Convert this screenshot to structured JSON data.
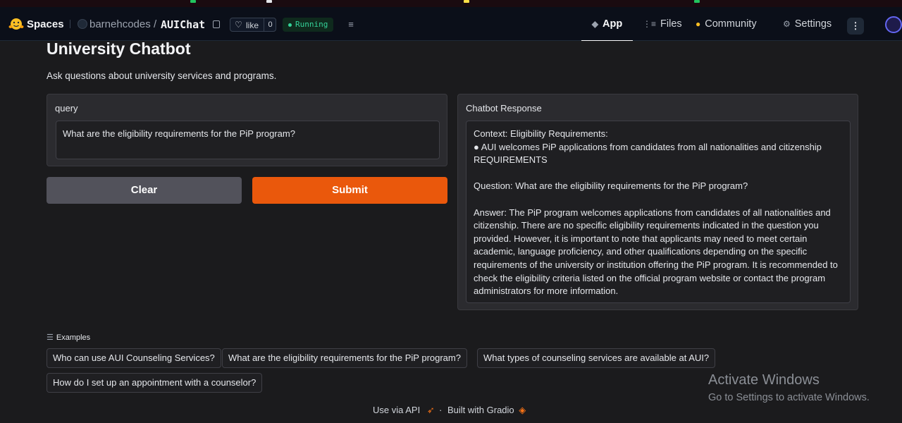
{
  "header": {
    "brand": "Spaces",
    "owner": "barnehcodes",
    "slash": "/",
    "repo": "AUIChat",
    "like_label": "like",
    "like_count": "0",
    "status": "Running",
    "nav": {
      "app": "App",
      "files": "Files",
      "community": "Community",
      "settings": "Settings"
    }
  },
  "page": {
    "title": "University Chatbot",
    "description": "Ask questions about university services and programs."
  },
  "query": {
    "label": "query",
    "value": "What are the eligibility requirements for the PiP program?"
  },
  "buttons": {
    "clear": "Clear",
    "submit": "Submit"
  },
  "response": {
    "label": "Chatbot Response",
    "lines": [
      "Context: Eligibility  Requirements:",
      "● AUI welcomes PiP applications from candidates from all nationalities and citizenship REQUIREMENTS",
      "",
      "Question: What are the eligibility requirements for the PiP program?",
      "",
      "Answer: The PiP program welcomes applications from candidates of all nationalities and citizenship. There are no specific eligibility requirements indicated in the question you provided. However, it is important to note that applicants may need to meet certain academic, language proficiency, and other qualifications depending on the specific requirements of the university or institution offering the PiP program. It is recommended to check the eligibility criteria listed on the official program website or contact the program administrators for more information."
    ]
  },
  "examples": {
    "label": "Examples",
    "items": [
      "Who can use AUI Counseling Services?",
      "What are the eligibility requirements for the PiP program?",
      "What types of counseling services are available at AUI?",
      "How do I set up an appointment with a counselor?"
    ]
  },
  "footer": {
    "api": "Use via API",
    "dot": "·",
    "built": "Built with Gradio"
  },
  "watermark": {
    "title": "Activate Windows",
    "subtitle": "Go to Settings to activate Windows."
  },
  "colors": {
    "accent": "#ea580c",
    "status": "#34d399",
    "clear": "#52525b"
  }
}
